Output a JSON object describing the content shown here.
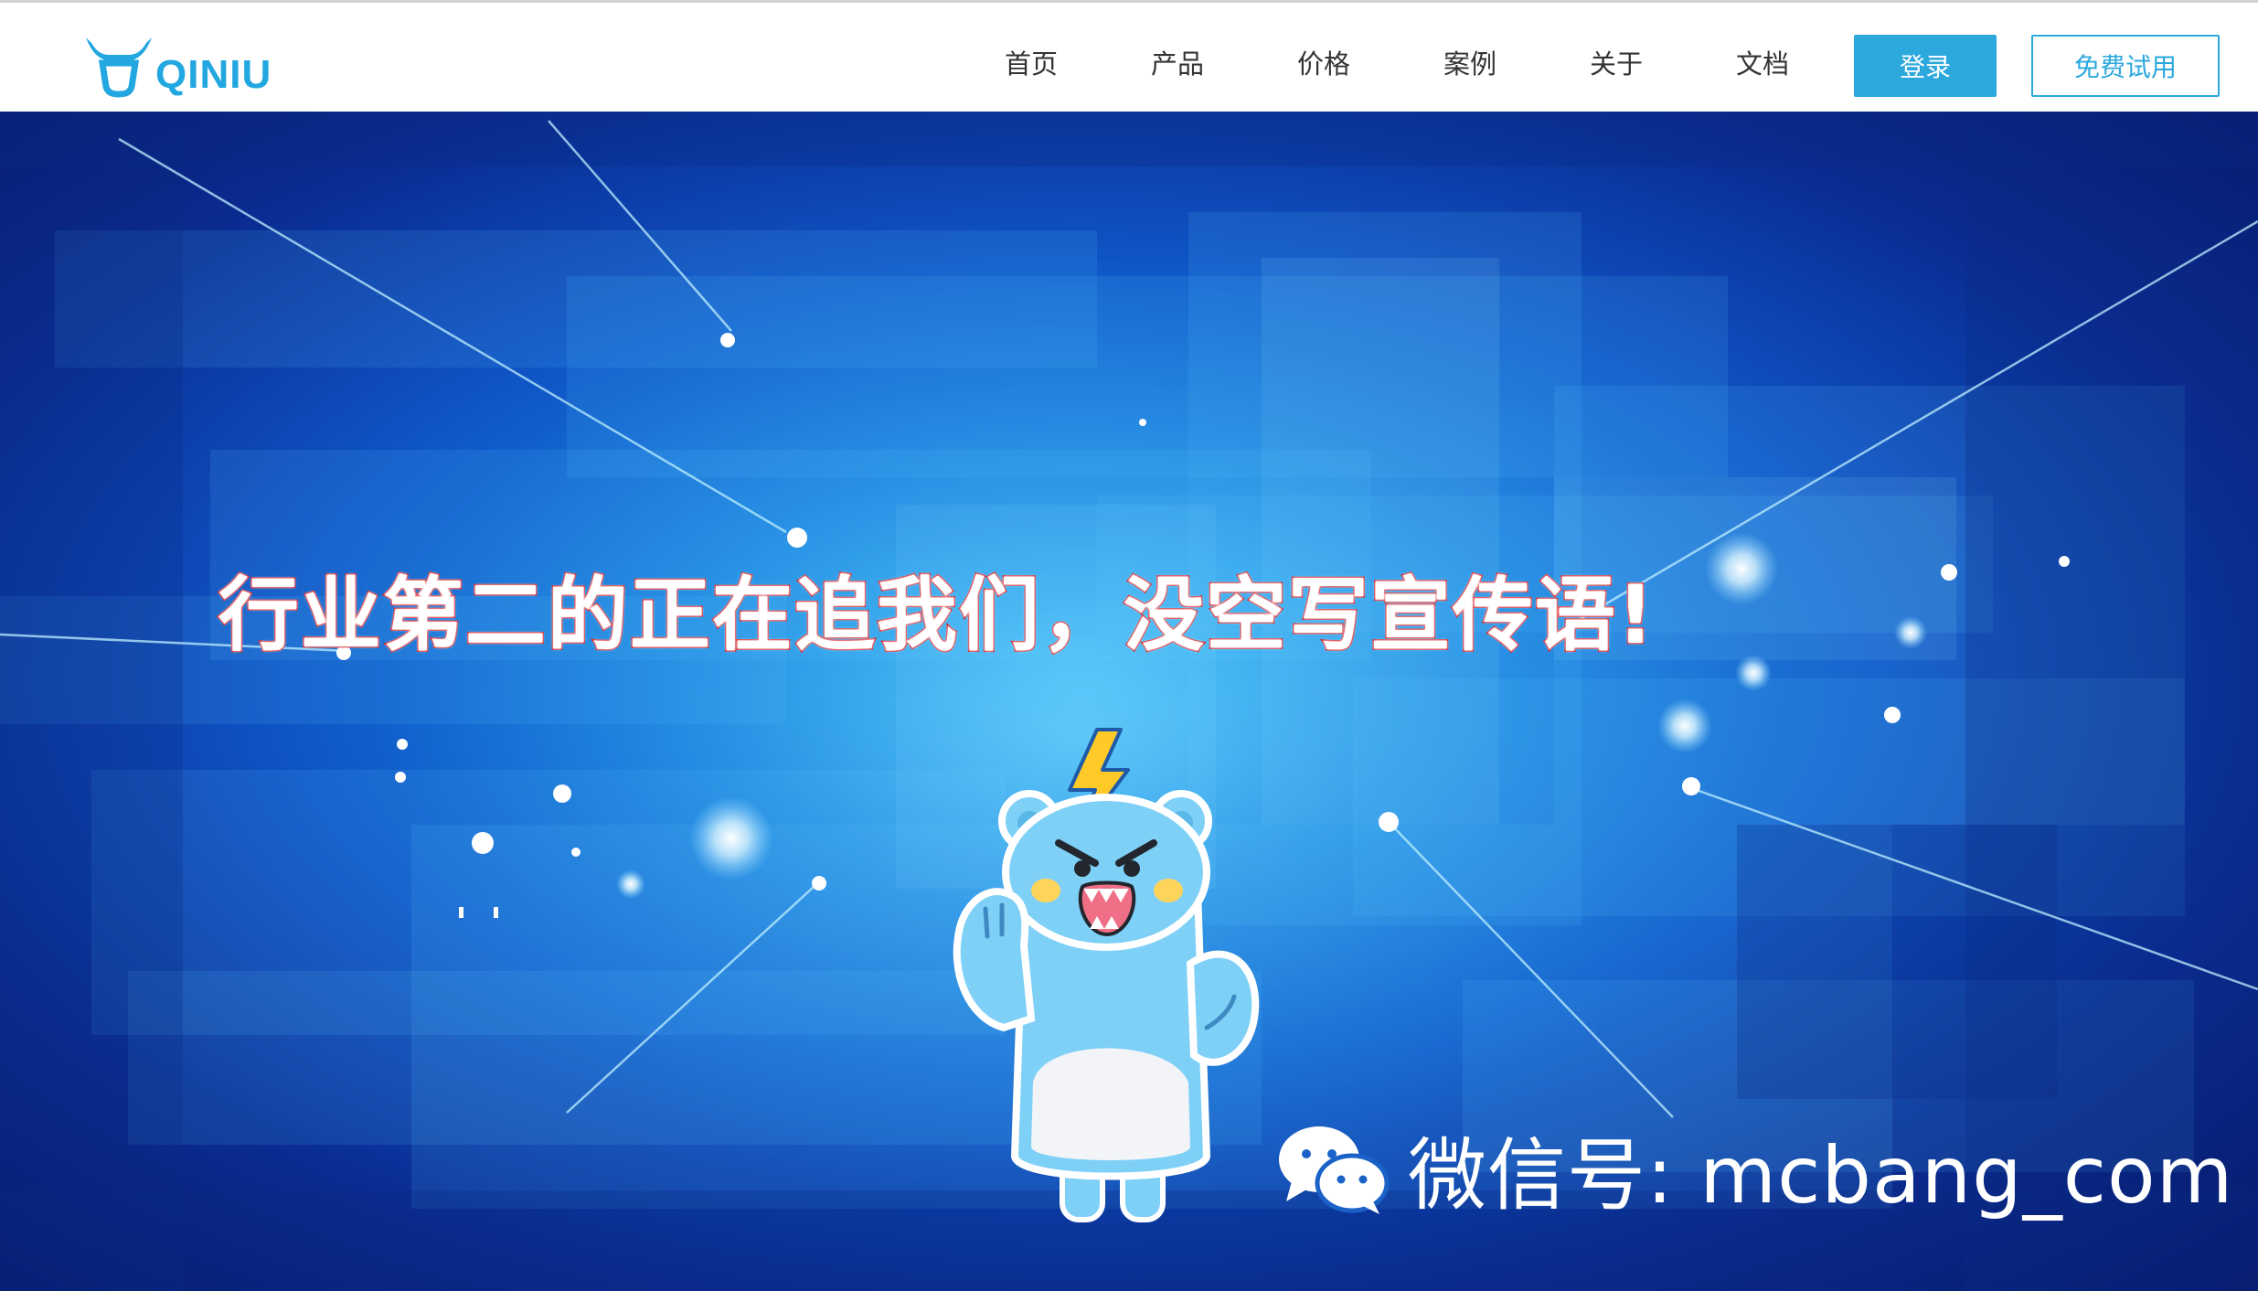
{
  "brand": {
    "name": "QINIU",
    "accent_color": "#2ca8dd",
    "logo_icon": "bull-horns-logo-icon"
  },
  "nav": {
    "items": [
      {
        "label": "首页"
      },
      {
        "label": "产品"
      },
      {
        "label": "价格"
      },
      {
        "label": "案例"
      },
      {
        "label": "关于"
      },
      {
        "label": "文档"
      }
    ],
    "login_label": "登录",
    "trial_label": "免费试用"
  },
  "hero": {
    "slogan": "行业第二的正在追我们，没空写宣传语!",
    "slogan_outline_color": "#d8232a",
    "mascot": "angry-blue-bear-mascot",
    "mascot_badge_icon": "lightning-bolt-icon"
  },
  "watermark": {
    "icon": "wechat-icon",
    "text": "微信号: mcbang_com"
  }
}
